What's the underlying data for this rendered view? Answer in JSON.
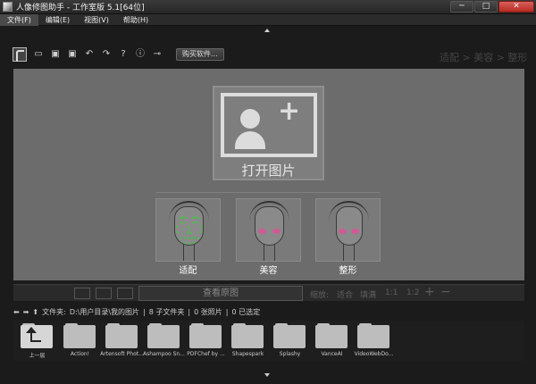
{
  "window": {
    "title": "人像修图助手 - 工作室版 5.1[64位]",
    "minimize_symbol": "─",
    "maximize_symbol": "□",
    "close_symbol": "✕"
  },
  "menu": {
    "items": [
      "文件(F)",
      "编辑(E)",
      "视图(V)",
      "帮助(H)"
    ]
  },
  "toolbar": {
    "icons": [
      "folder-icon",
      "save-icon",
      "save-as-icon",
      "undo-icon",
      "redo-icon",
      "help-icon",
      "info-icon",
      "plugin-icon"
    ],
    "symbols": [
      "▭",
      "▣",
      "▣",
      "↶",
      "↷",
      "?",
      "ⓘ",
      "⊸"
    ],
    "buy_label": "购买软件..."
  },
  "breadcrumb": "适配 > 美容 > 整形",
  "main": {
    "open_label": "打开图片",
    "faces": [
      {
        "label": "适配"
      },
      {
        "label": "美容"
      },
      {
        "label": "整形"
      }
    ]
  },
  "viewbar": {
    "view_original": "查看原图",
    "zoom_label": "缩放:",
    "fit": "适合",
    "fill": "填满",
    "ratio_1": "1:1",
    "ratio_2": "1:2",
    "plus": "+",
    "minus": "−"
  },
  "pathbar": {
    "back_symbol": "⬅",
    "forward_symbol": "➡",
    "up_symbol": "⬆",
    "label": "文件夹:",
    "path": "D:\\用户目录\\我的图片",
    "subfolders": "8 子文件夹",
    "photos": "0 张照片",
    "selected": "0 已选定"
  },
  "folders": [
    {
      "name": "上一层"
    },
    {
      "name": "Action!"
    },
    {
      "name": "Artensoft Phot..."
    },
    {
      "name": "Ashampoo Sn..."
    },
    {
      "name": "PDFChef by ..."
    },
    {
      "name": "Shapespark"
    },
    {
      "name": "Splashy"
    },
    {
      "name": "VanceAI"
    },
    {
      "name": "VideoWebDo..."
    }
  ]
}
